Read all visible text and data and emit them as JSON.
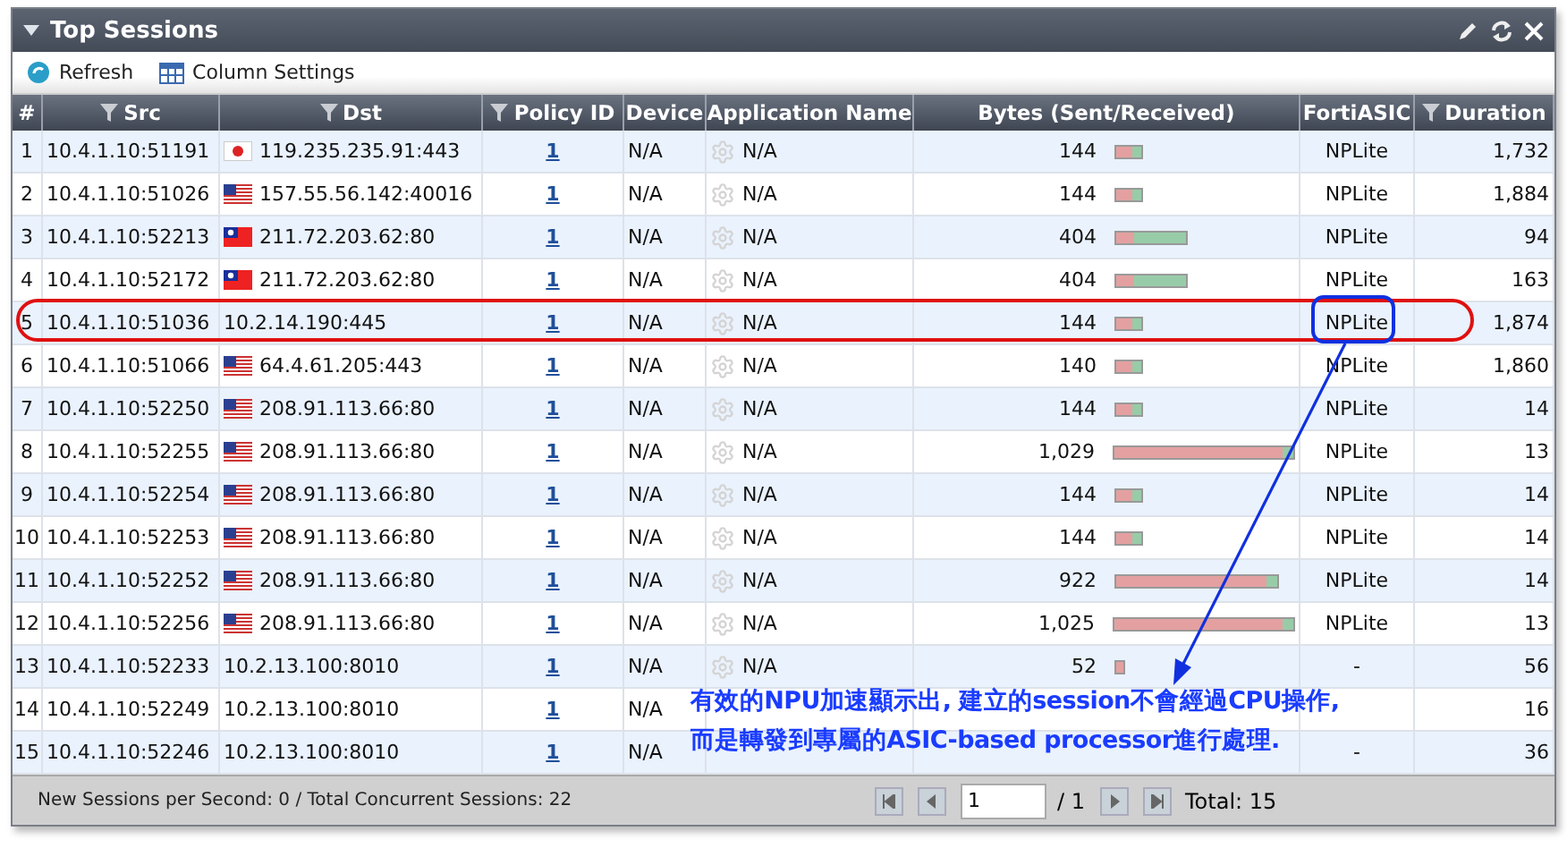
{
  "window": {
    "title": "Top Sessions"
  },
  "toolbar": [
    {
      "kind": "refresh",
      "label": "Refresh"
    },
    {
      "kind": "columns",
      "label": "Column Settings"
    }
  ],
  "table": {
    "columns": [
      {
        "label": "#",
        "filter": false
      },
      {
        "label": "Src",
        "filter": true
      },
      {
        "label": "Dst",
        "filter": true
      },
      {
        "label": "Policy ID",
        "filter": true
      },
      {
        "label": "Device",
        "filter": false
      },
      {
        "label": "Application Name",
        "filter": false
      },
      {
        "label": "Bytes (Sent/Received)",
        "filter": false
      },
      {
        "label": "FortiASIC",
        "filter": false
      },
      {
        "label": "Duration",
        "filter": true
      }
    ],
    "rows": [
      {
        "kind": "japan",
        "num": "1",
        "src": "10.4.1.10:51191",
        "dst": "119.235.235.91:443",
        "policy": "1",
        "device": "N/A",
        "app": "N/A",
        "bytes": "144",
        "bar": {
          "kind": "short"
        },
        "asic": "NPLite",
        "duration": "1,732"
      },
      {
        "kind": "usa",
        "num": "2",
        "src": "10.4.1.10:51026",
        "dst": "157.55.56.142:40016",
        "policy": "1",
        "device": "N/A",
        "app": "N/A",
        "bytes": "144",
        "bar": {
          "kind": "short"
        },
        "asic": "NPLite",
        "duration": "1,884"
      },
      {
        "kind": "taiwan",
        "num": "3",
        "src": "10.4.1.10:52213",
        "dst": "211.72.203.62:80",
        "policy": "1",
        "device": "N/A",
        "app": "N/A",
        "bytes": "404",
        "bar": {
          "kind": "medium"
        },
        "asic": "NPLite",
        "duration": "94"
      },
      {
        "kind": "taiwan",
        "num": "4",
        "src": "10.4.1.10:52172",
        "dst": "211.72.203.62:80",
        "policy": "1",
        "device": "N/A",
        "app": "N/A",
        "bytes": "404",
        "bar": {
          "kind": "medium"
        },
        "asic": "NPLite",
        "duration": "163"
      },
      {
        "kind": "plain",
        "num": "5",
        "src": "10.4.1.10:51036",
        "dst": "10.2.14.190:445",
        "policy": "1",
        "device": "N/A",
        "app": "N/A",
        "bytes": "144",
        "bar": {
          "kind": "short"
        },
        "asic": "NPLite",
        "duration": "1,874"
      },
      {
        "kind": "usa",
        "num": "6",
        "src": "10.4.1.10:51066",
        "dst": "64.4.61.205:443",
        "policy": "1",
        "device": "N/A",
        "app": "N/A",
        "bytes": "140",
        "bar": {
          "kind": "short"
        },
        "asic": "NPLite",
        "duration": "1,860"
      },
      {
        "kind": "usa",
        "num": "7",
        "src": "10.4.1.10:52250",
        "dst": "208.91.113.66:80",
        "policy": "1",
        "device": "N/A",
        "app": "N/A",
        "bytes": "144",
        "bar": {
          "kind": "short"
        },
        "asic": "NPLite",
        "duration": "14"
      },
      {
        "kind": "usa",
        "num": "8",
        "src": "10.4.1.10:52255",
        "dst": "208.91.113.66:80",
        "policy": "1",
        "device": "N/A",
        "app": "N/A",
        "bytes": "1,029",
        "bar": {
          "kind": "full"
        },
        "asic": "NPLite",
        "duration": "13"
      },
      {
        "kind": "usa",
        "num": "9",
        "src": "10.4.1.10:52254",
        "dst": "208.91.113.66:80",
        "policy": "1",
        "device": "N/A",
        "app": "N/A",
        "bytes": "144",
        "bar": {
          "kind": "short"
        },
        "asic": "NPLite",
        "duration": "14"
      },
      {
        "kind": "usa",
        "num": "10",
        "src": "10.4.1.10:52253",
        "dst": "208.91.113.66:80",
        "policy": "1",
        "device": "N/A",
        "app": "N/A",
        "bytes": "144",
        "bar": {
          "kind": "short"
        },
        "asic": "NPLite",
        "duration": "14"
      },
      {
        "kind": "usa",
        "num": "11",
        "src": "10.4.1.10:52252",
        "dst": "208.91.113.66:80",
        "policy": "1",
        "device": "N/A",
        "app": "N/A",
        "bytes": "922",
        "bar": {
          "kind": "long"
        },
        "asic": "NPLite",
        "duration": "14"
      },
      {
        "kind": "usa",
        "num": "12",
        "src": "10.4.1.10:52256",
        "dst": "208.91.113.66:80",
        "policy": "1",
        "device": "N/A",
        "app": "N/A",
        "bytes": "1,025",
        "bar": {
          "kind": "full"
        },
        "asic": "NPLite",
        "duration": "13"
      },
      {
        "kind": "plain",
        "num": "13",
        "src": "10.4.1.10:52233",
        "dst": "10.2.13.100:8010",
        "policy": "1",
        "device": "N/A",
        "app": "N/A",
        "bytes": "52",
        "bar": {
          "kind": "tiny"
        },
        "asic": "-",
        "duration": "56"
      },
      {
        "kind": "plain",
        "num": "14",
        "src": "10.4.1.10:52249",
        "dst": "10.2.13.100:8010",
        "policy": "1",
        "device": "N/A",
        "duration": "16"
      },
      {
        "kind": "plain",
        "num": "15",
        "src": "10.4.1.10:52246",
        "dst": "10.2.13.100:8010",
        "policy": "1",
        "device": "N/A",
        "asic": "-",
        "duration": "36"
      }
    ]
  },
  "status_bar": {
    "text": "New Sessions per Second: 0 / Total Concurrent Sessions: 22",
    "page": "1",
    "pages": "/ 1",
    "total": "Total: 15"
  },
  "annotation": {
    "lines": [
      "有效的NPU加速顯示出, 建立的session不會經過CPU操作,",
      "而是轉發到專屬的ASIC-based processor進行處理."
    ]
  }
}
